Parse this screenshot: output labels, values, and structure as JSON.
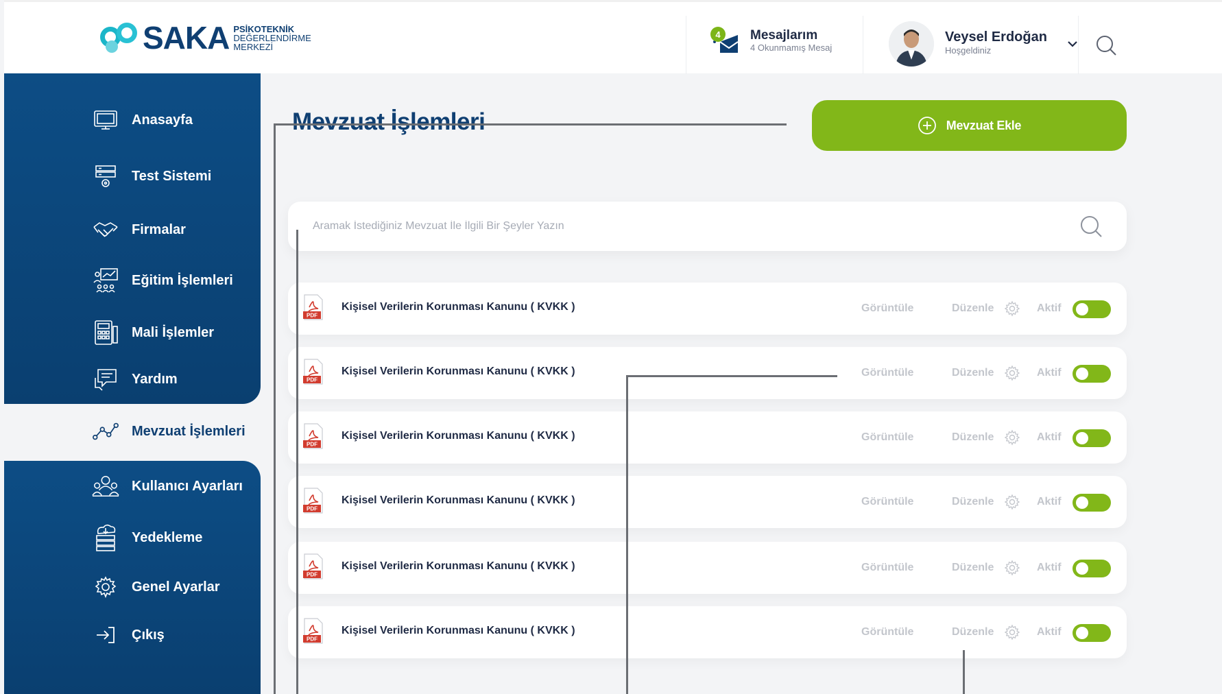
{
  "brand": {
    "name": "SAKA",
    "sub_line1": "PSİKOTEKNİK",
    "sub_line2": "DEĞERLENDİRME",
    "sub_line3": "MERKEZİ"
  },
  "header": {
    "messages": {
      "badge": "4",
      "title": "Mesajlarım",
      "subtitle": "4 Okunmamış Mesaj"
    },
    "user": {
      "name": "Veysel Erdoğan",
      "greeting": "Hoşgeldiniz"
    }
  },
  "sidebar": {
    "items": [
      {
        "label": "Anasayfa",
        "icon": "monitor-icon"
      },
      {
        "label": "Test Sistemi",
        "icon": "server-gear-icon"
      },
      {
        "label": "Firmalar",
        "icon": "handshake-icon"
      },
      {
        "label": "Eğitim İşlemleri",
        "icon": "training-board-icon"
      },
      {
        "label": "Mali İşlemler",
        "icon": "calculator-icon"
      },
      {
        "label": "Yardım",
        "icon": "help-chat-icon"
      },
      {
        "label": "Mevzuat İşlemleri",
        "icon": "chart-nodes-icon",
        "active": true
      },
      {
        "label": "Kullanıcı Ayarları",
        "icon": "users-icon"
      },
      {
        "label": "Yedekleme",
        "icon": "cloud-backup-icon"
      },
      {
        "label": "Genel Ayarlar",
        "icon": "gear-icon"
      },
      {
        "label": "Çıkış",
        "icon": "logout-icon"
      }
    ]
  },
  "main": {
    "title": "Mevzuat İşlemleri",
    "add_button": "Mevzuat Ekle",
    "search_placeholder": "Aramak İstediğiniz Mevzuat İle İlgili Bir Şeyler Yazın",
    "row_actions": {
      "view": "Görüntüle",
      "edit": "Düzenle",
      "status": "Aktif"
    },
    "documents": [
      {
        "title": "Kişisel Verilerin Korunması Kanunu ( KVKK )",
        "active": true
      },
      {
        "title": "Kişisel Verilerin Korunması Kanunu ( KVKK )",
        "active": true
      },
      {
        "title": "Kişisel Verilerin Korunması Kanunu ( KVKK )",
        "active": true
      },
      {
        "title": "Kişisel Verilerin Korunması Kanunu ( KVKK )",
        "active": true
      },
      {
        "title": "Kişisel Verilerin Korunması Kanunu ( KVKK )",
        "active": true
      },
      {
        "title": "Kişisel Verilerin Korunması Kanunu ( KVKK )",
        "active": true
      }
    ]
  },
  "colors": {
    "sidebar": "#0d4d85",
    "accent_green": "#82b719",
    "title_blue": "#0f3f72",
    "muted_text": "#c3c6cc"
  }
}
